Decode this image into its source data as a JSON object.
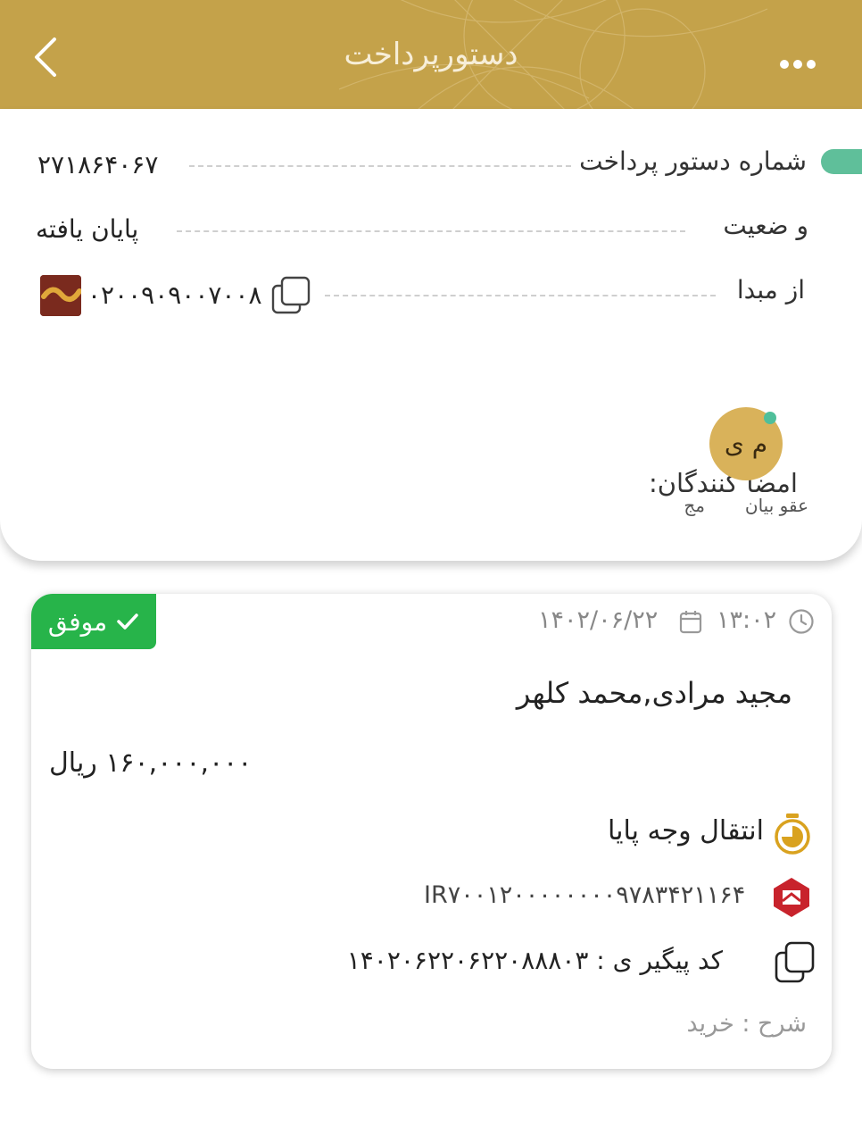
{
  "header": {
    "title": "دستورپرداخت",
    "color": "#c4a24a"
  },
  "order": {
    "number_label": "شماره دستور پرداخت",
    "number_value": "۲۷۱۸۶۴۰۶۷",
    "status_label": "و ضعیت",
    "status_value": "پایان یافته",
    "source_label": "از مبدا",
    "source_value": "۰۲۰۰۹۰۹۰۰۷۰۰۸",
    "signers_label": "امضا کنندگان:",
    "signer": {
      "initials": "م ی",
      "name_first": "عقو بیان",
      "name_second": "مج"
    }
  },
  "transaction": {
    "status_label": "موفق",
    "status_color": "#27b44a",
    "time": "۱۳:۰۲",
    "date": "۱۴۰۲/۰۶/۲۲",
    "names": "مجید  مرادی,محمد  کلهر",
    "amount": "۱۶۰,۰۰۰,۰۰۰  ریال",
    "type": "انتقال وجه پایا",
    "iban": "IR۷۰۰۱۲۰۰۰۰۰۰۰۰۹۷۸۳۴۲۱۱۶۴",
    "tracking": "کد پیگیر ی : ۱۴۰۲۰۶۲۲۰۶۲۲۰۸۸۸۰۳",
    "description": "شرح : خرید"
  },
  "icons": {
    "back": "chevron-left-icon",
    "more": "more-horizontal-icon",
    "copy": "copy-icon",
    "calendar": "calendar-icon",
    "clock": "clock-icon",
    "timer": "stopwatch-icon",
    "check": "check-icon"
  }
}
